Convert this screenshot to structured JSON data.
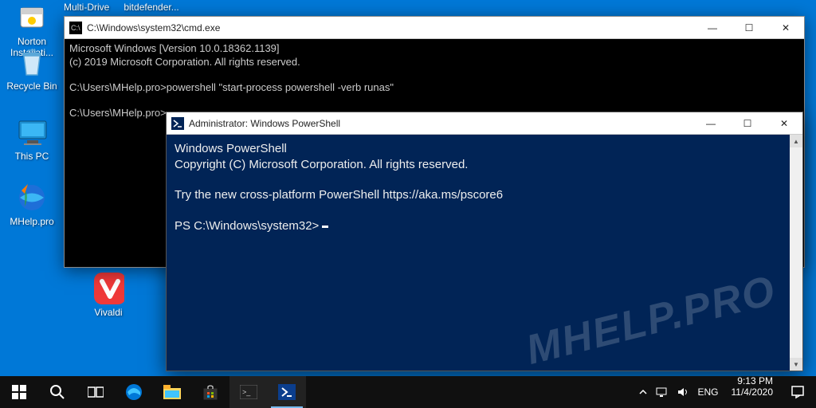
{
  "desktop": {
    "icons": [
      {
        "label": "Norton Installati..."
      },
      {
        "label": "Recycle Bin"
      },
      {
        "label": "This PC"
      },
      {
        "label": "MHelp.pro"
      },
      {
        "label": "Vivaldi"
      }
    ]
  },
  "top_menu": {
    "item1": "Multi-Drive",
    "item2": "bitdefender..."
  },
  "cmd": {
    "title": "C:\\Windows\\system32\\cmd.exe",
    "line1": "Microsoft Windows [Version 10.0.18362.1139]",
    "line2": "(c) 2019 Microsoft Corporation. All rights reserved.",
    "line3": "C:\\Users\\MHelp.pro>powershell \"start-process powershell -verb runas\"",
    "line4": "C:\\Users\\MHelp.pro>"
  },
  "ps": {
    "title": "Administrator: Windows PowerShell",
    "line1": "Windows PowerShell",
    "line2": "Copyright (C) Microsoft Corporation. All rights reserved.",
    "line3": "Try the new cross-platform PowerShell https://aka.ms/pscore6",
    "prompt": "PS C:\\Windows\\system32> "
  },
  "watermark": "MHELP.PRO",
  "taskbar": {
    "tray_lang": "ENG",
    "time": "9:13 PM",
    "date": "11/4/2020"
  },
  "controls": {
    "min": "—",
    "max": "☐",
    "close": "✕",
    "up": "▲",
    "down": "▼"
  }
}
